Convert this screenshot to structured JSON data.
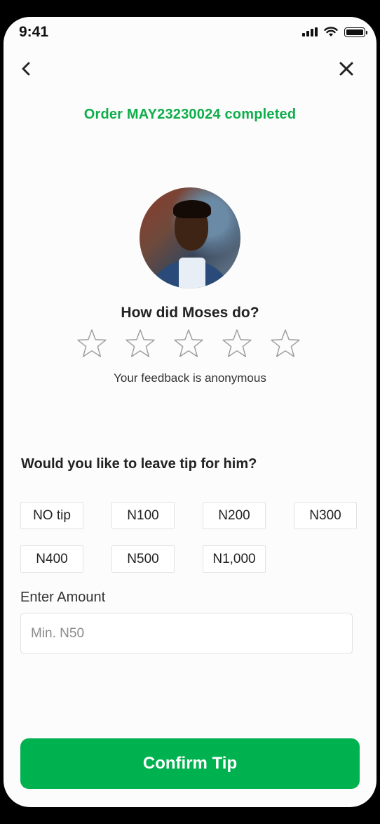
{
  "status_bar": {
    "time": "9:41"
  },
  "nav": {
    "back_icon": "chevron-left-icon",
    "close_icon": "close-icon"
  },
  "order": {
    "title": "Order MAY23230024 completed"
  },
  "rating": {
    "question": "How did Moses do?",
    "stars_total": 5,
    "stars_selected": 0,
    "note": "Your feedback is anonymous"
  },
  "tip": {
    "question": "Would you like to leave tip for him?",
    "options": [
      "NO tip",
      "N100",
      "N200",
      "N300",
      "N400",
      "N500",
      "N1,000"
    ],
    "amount_label": "Enter Amount",
    "amount_placeholder": "Min. N50",
    "amount_value": ""
  },
  "actions": {
    "confirm_label": "Confirm Tip"
  },
  "colors": {
    "accent": "#00b14f",
    "title_green": "#0fae4c",
    "star_outline": "#9a9a9a"
  }
}
